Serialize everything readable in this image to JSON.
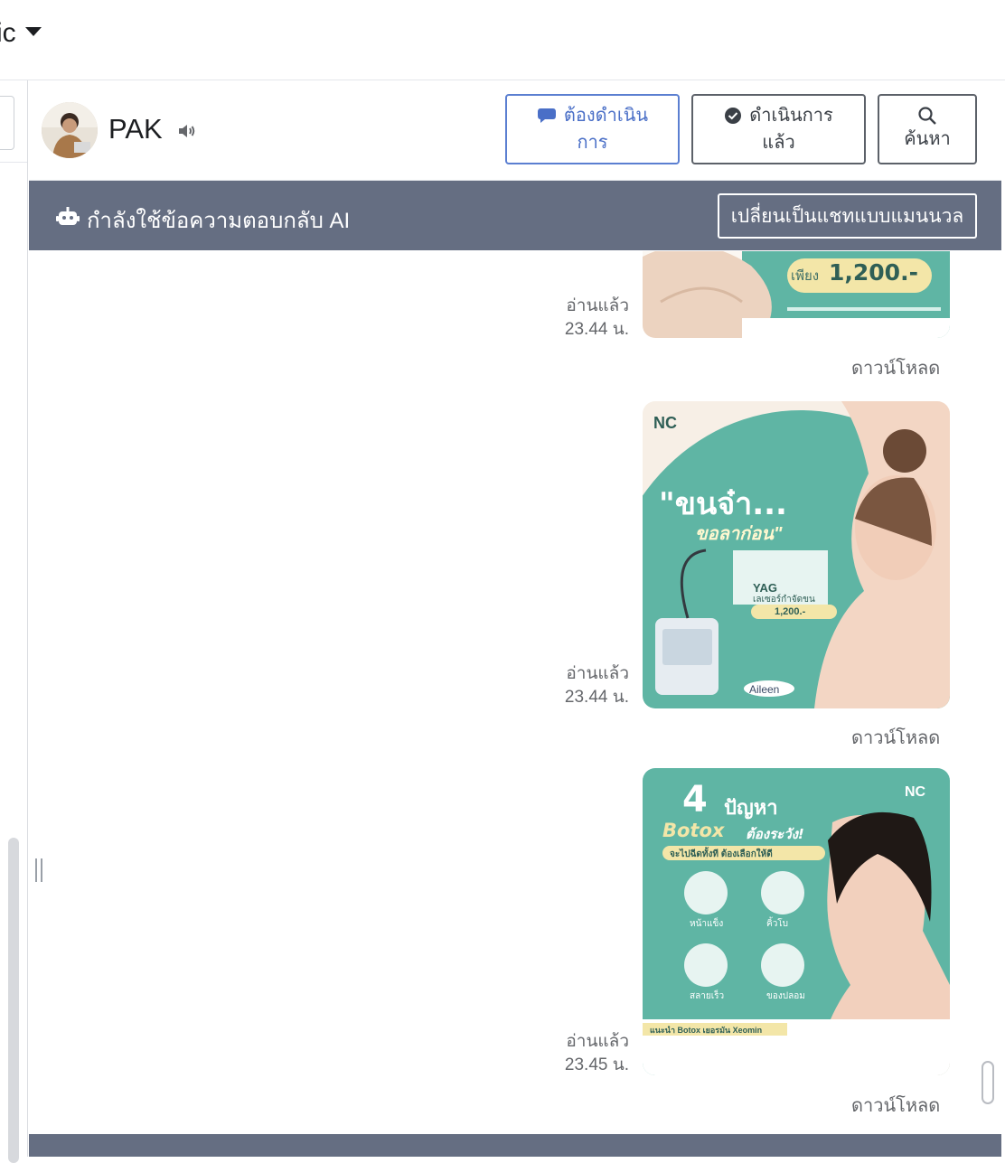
{
  "topbar": {
    "title": "ic"
  },
  "contact": {
    "name": "PAK"
  },
  "header_buttons": {
    "todo": {
      "line1": "ต้องดำเนิน",
      "line2": "การ"
    },
    "done": {
      "line1": "ดำเนินการ",
      "line2": "แล้ว"
    },
    "search": {
      "label": "ค้นหา"
    }
  },
  "ai_bar": {
    "text": "กำลังใช้ข้อความตอบกลับ AI",
    "switch_label": "เปลี่ยนเป็นแชทแบบแมนนวล"
  },
  "messages": [
    {
      "read_label": "อ่านแล้ว",
      "time": "23.44 น.",
      "download_label": "ดาวน์โหลด",
      "image_text": {
        "price_prefix": "เพียง",
        "price": "1,200.-"
      }
    },
    {
      "read_label": "อ่านแล้ว",
      "time": "23.44 น.",
      "download_label": "ดาวน์โหลด",
      "image_text": {
        "headline": "\"ขนจ๋า...",
        "subheadline": "ขอลาก่อน\"",
        "yag": "YAG",
        "yag_sub": "เลเซอร์กำจัดขน",
        "price": "1,200.-",
        "brand": "Aileen",
        "logo": "NC"
      }
    },
    {
      "read_label": "อ่านแล้ว",
      "time": "23.45 น.",
      "download_label": "ดาวน์โหลด",
      "image_text": {
        "number": "4",
        "headline": "ปัญหา",
        "botox": "Botox",
        "caution": "ต้องระวัง!",
        "tagline": "จะไปฉีดทั้งที ต้องเลือกให้ดี",
        "items": [
          "หน้าแข็ง",
          "คิ้วโบ",
          "สลายเร็ว",
          "ของปลอม"
        ],
        "recommend": "แนะนำ Botox เยอรมัน Xeomin",
        "logo": "NC"
      }
    }
  ],
  "colors": {
    "ai_bar": "#656e82",
    "accent_blue": "#4a6fc7",
    "promo_teal": "#5fb5a4"
  }
}
